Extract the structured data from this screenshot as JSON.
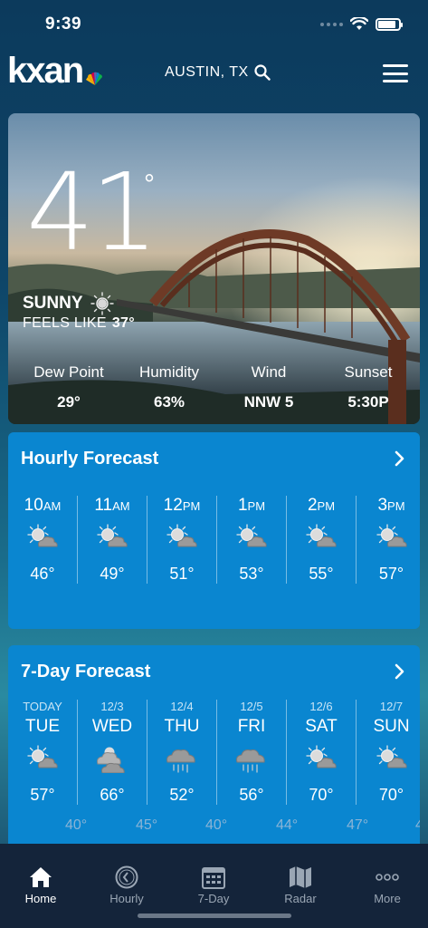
{
  "status_bar": {
    "time": "9:39"
  },
  "header": {
    "logo_text": "kxan",
    "location": "AUSTIN, TX"
  },
  "current": {
    "temperature": "41",
    "degree": "°",
    "condition": "SUNNY",
    "feels_like_label": "FEELS LIKE",
    "feels_like_value": "37°",
    "stats": [
      {
        "label": "Dew Point",
        "value": "29°"
      },
      {
        "label": "Humidity",
        "value": "63%"
      },
      {
        "label": "Wind",
        "value": "NNW 5"
      },
      {
        "label": "Sunset",
        "value": "5:30P"
      }
    ]
  },
  "hourly": {
    "title": "Hourly Forecast",
    "items": [
      {
        "hour": "10",
        "ampm": "AM",
        "temp": "46°",
        "icon": "partly-sunny-icon"
      },
      {
        "hour": "11",
        "ampm": "AM",
        "temp": "49°",
        "icon": "partly-sunny-icon"
      },
      {
        "hour": "12",
        "ampm": "PM",
        "temp": "51°",
        "icon": "partly-sunny-icon"
      },
      {
        "hour": "1",
        "ampm": "PM",
        "temp": "53°",
        "icon": "partly-sunny-icon"
      },
      {
        "hour": "2",
        "ampm": "PM",
        "temp": "55°",
        "icon": "partly-sunny-icon"
      },
      {
        "hour": "3",
        "ampm": "PM",
        "temp": "57°",
        "icon": "partly-sunny-icon"
      }
    ]
  },
  "seven_day": {
    "title": "7-Day Forecast",
    "days": [
      {
        "date": "TODAY",
        "day": "TUE",
        "high": "57°",
        "icon": "partly-sunny-icon"
      },
      {
        "date": "12/3",
        "day": "WED",
        "high": "66°",
        "icon": "mostly-cloudy-icon"
      },
      {
        "date": "12/4",
        "day": "THU",
        "high": "52°",
        "icon": "rain-icon"
      },
      {
        "date": "12/5",
        "day": "FRI",
        "high": "56°",
        "icon": "rain-icon"
      },
      {
        "date": "12/6",
        "day": "SAT",
        "high": "70°",
        "icon": "partly-sunny-icon"
      },
      {
        "date": "12/7",
        "day": "SUN",
        "high": "70°",
        "icon": "partly-sunny-icon"
      }
    ],
    "lows": [
      "40°",
      "45°",
      "40°",
      "44°",
      "47°",
      "4"
    ]
  },
  "tabs": [
    {
      "label": "Home",
      "icon": "home-icon",
      "active": true
    },
    {
      "label": "Hourly",
      "icon": "clock-icon",
      "active": false
    },
    {
      "label": "7-Day",
      "icon": "calendar-icon",
      "active": false
    },
    {
      "label": "Radar",
      "icon": "map-icon",
      "active": false
    },
    {
      "label": "More",
      "icon": "more-icon",
      "active": false
    }
  ]
}
